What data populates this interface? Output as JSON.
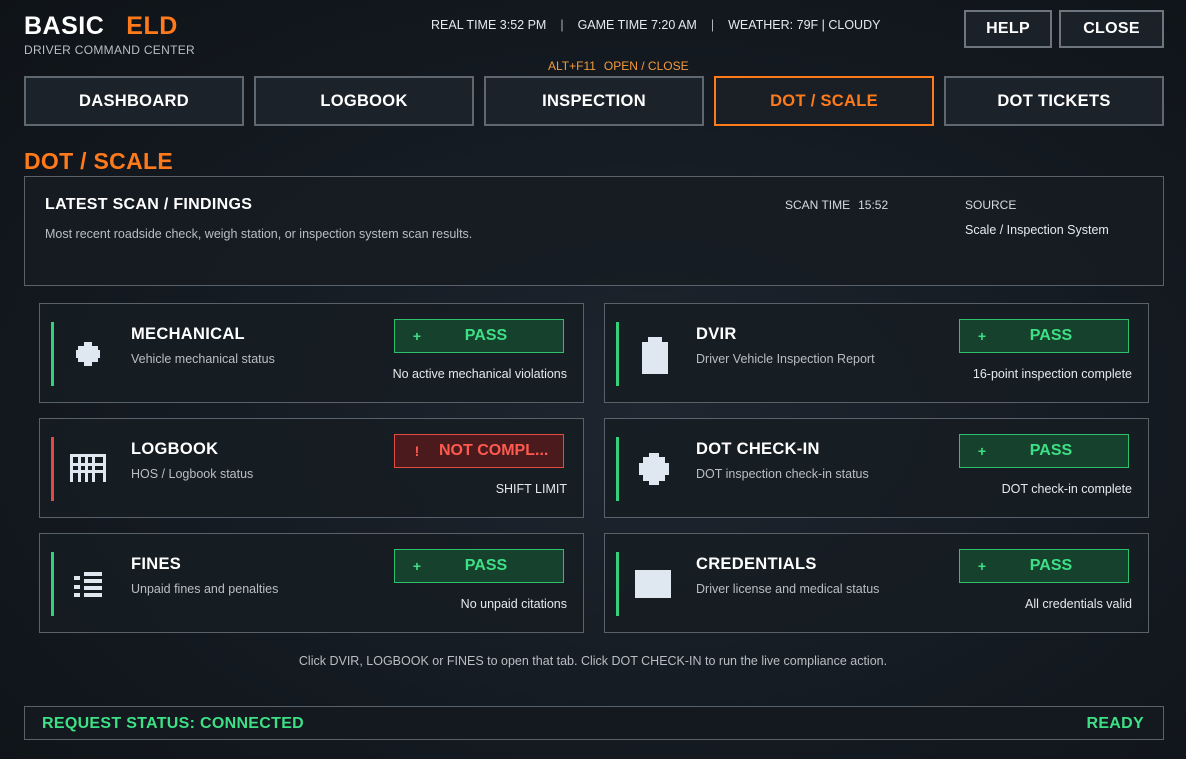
{
  "header": {
    "brand_primary": "BASIC",
    "brand_accent": "ELD",
    "subtitle": "DRIVER COMMAND CENTER",
    "real_time": "REAL TIME 3:52 PM",
    "game_time": "GAME TIME 7:20 AM",
    "weather": "WEATHER: 79F | CLOUDY",
    "separator": "|",
    "hotkey": "ALT+F11",
    "hotkey_action": "OPEN / CLOSE",
    "help_label": "HELP",
    "close_label": "CLOSE"
  },
  "tabs": [
    {
      "label": "DASHBOARD",
      "active": false
    },
    {
      "label": "LOGBOOK",
      "active": false
    },
    {
      "label": "INSPECTION",
      "active": false
    },
    {
      "label": "DOT / SCALE",
      "active": true
    },
    {
      "label": "DOT TICKETS",
      "active": false
    }
  ],
  "section_title": "DOT / SCALE",
  "scan": {
    "title": "LATEST SCAN / FINDINGS",
    "description": "Most recent roadside check, weigh station, or inspection system scan results.",
    "time_label": "SCAN TIME",
    "time_value": "15:52",
    "source_label": "SOURCE",
    "source_value": "Scale / Inspection System"
  },
  "cards": [
    {
      "title": "MECHANICAL",
      "description": "Vehicle mechanical status",
      "status": "PASS",
      "status_symbol": "+",
      "note": "No active mechanical violations",
      "icon": "gear-icon"
    },
    {
      "title": "DVIR",
      "description": "Driver Vehicle Inspection Report",
      "status": "PASS",
      "status_symbol": "+",
      "note": "16-point inspection complete",
      "icon": "clipboard-icon"
    },
    {
      "title": "LOGBOOK",
      "description": "HOS / Logbook status",
      "status": "NOT COMPL...",
      "status_symbol": "!",
      "note": "SHIFT LIMIT",
      "icon": "logbook-grid-icon"
    },
    {
      "title": "DOT CHECK-IN",
      "description": "DOT inspection check-in status",
      "status": "PASS",
      "status_symbol": "+",
      "note": "DOT check-in complete",
      "icon": "badge-icon"
    },
    {
      "title": "FINES",
      "description": "Unpaid fines and penalties",
      "status": "PASS",
      "status_symbol": "+",
      "note": "No unpaid citations",
      "icon": "list-icon"
    },
    {
      "title": "CREDENTIALS",
      "description": "Driver license and medical status",
      "status": "PASS",
      "status_symbol": "+",
      "note": "All credentials valid",
      "icon": "id-card-icon"
    }
  ],
  "hint": "Click DVIR, LOGBOOK or FINES to open that tab. Click DOT CHECK-IN to run the live compliance action.",
  "footer": {
    "request_status": "REQUEST STATUS: CONNECTED",
    "ready": "READY"
  },
  "colors": {
    "accent": "#ff7a1a",
    "pass": "#3ee086",
    "fail": "#ff5a50"
  }
}
